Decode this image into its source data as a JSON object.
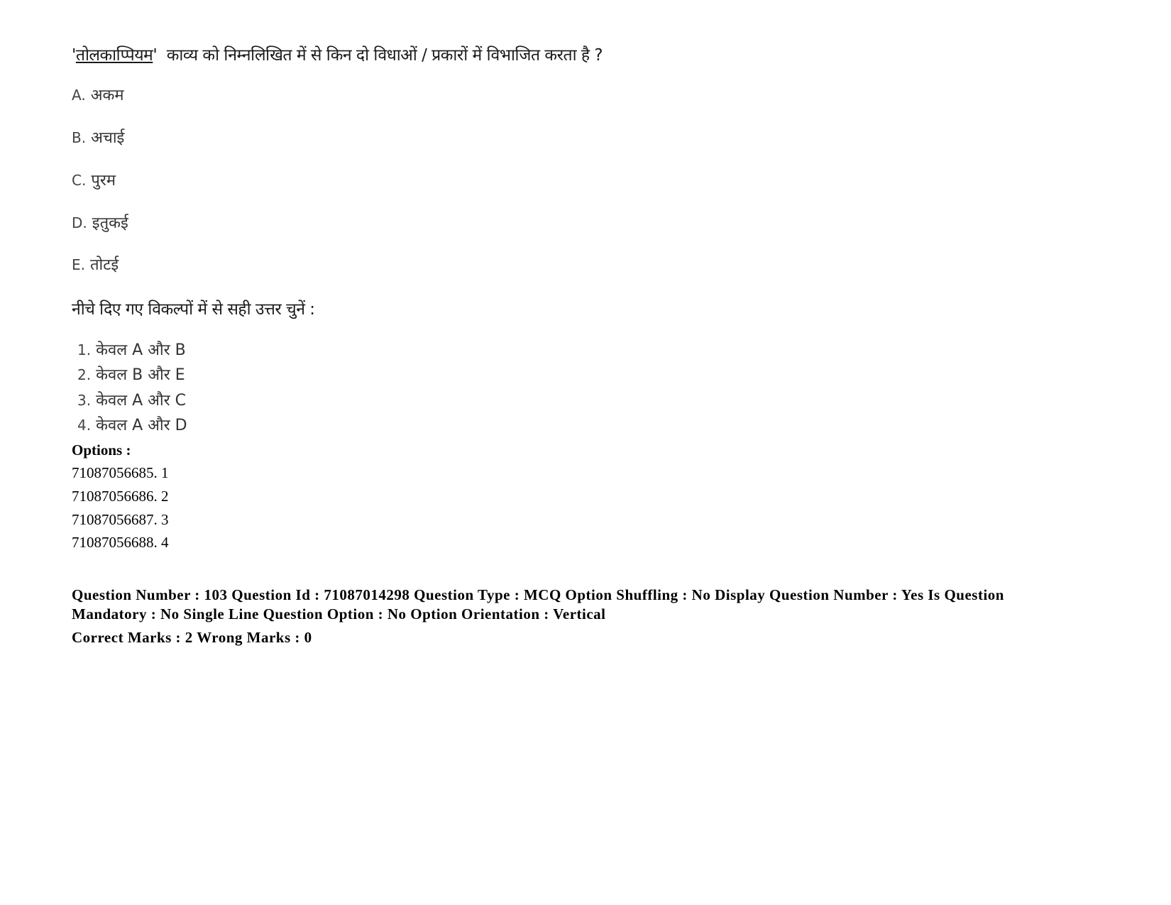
{
  "question": {
    "prefix_quote": "'",
    "term": "तोलकाप्पियम",
    "suffix_quote": "'",
    "text": "  काव्य को निम्नलिखित में से किन दो विधाओं / प्रकारों में विभाजित करता है ?"
  },
  "statements": [
    {
      "label": "A.",
      "text": "अकम"
    },
    {
      "label": "B.",
      "text": "अचाई"
    },
    {
      "label": "C.",
      "text": "पुरम"
    },
    {
      "label": "D.",
      "text": "इतुकई"
    },
    {
      "label": "E.",
      "text": "तोटई"
    }
  ],
  "instruction": "नीचे दिए गए विकल्पों में से सही उत्तर चुनें :",
  "choices": [
    {
      "label": "1.",
      "text": "केवल A और B"
    },
    {
      "label": "2.",
      "text": "केवल B और E"
    },
    {
      "label": "3.",
      "text": "केवल A और C"
    },
    {
      "label": "4.",
      "text": "केवल A और D"
    }
  ],
  "options_heading": "Options :",
  "option_ids": [
    "71087056685. 1",
    "71087056686. 2",
    "71087056687. 3",
    "71087056688. 4"
  ],
  "meta": {
    "details": "Question Number : 103 Question Id : 71087014298 Question Type : MCQ Option Shuffling : No Display Question Number : Yes Is Question Mandatory : No Single Line Question Option : No Option Orientation : Vertical",
    "marks": "Correct Marks : 2 Wrong Marks : 0"
  }
}
